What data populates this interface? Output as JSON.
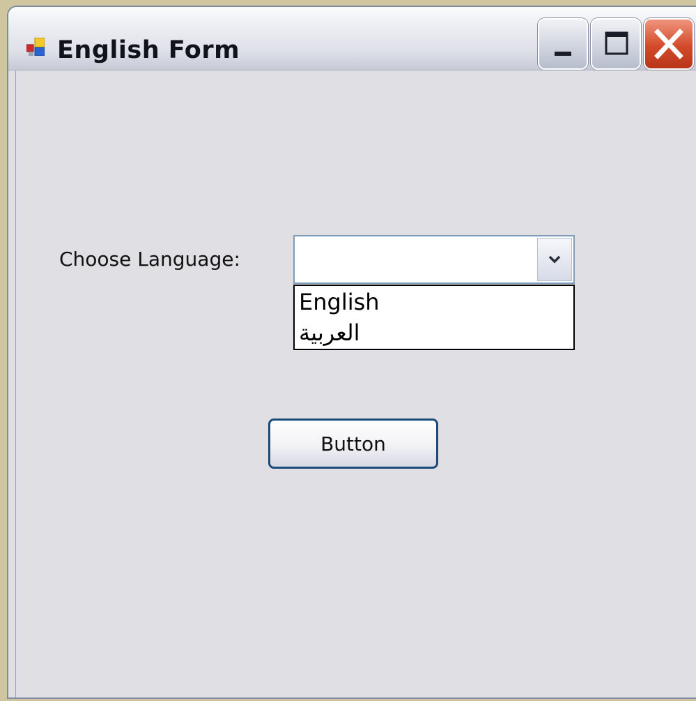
{
  "window": {
    "title": "English Form",
    "controls": [
      "minimize",
      "maximize",
      "close"
    ]
  },
  "form": {
    "language_label": "Choose Language:",
    "language_combo": {
      "selected": "",
      "options": [
        "English",
        "العربية"
      ]
    },
    "button_label": "Button"
  },
  "icons": {
    "app": "window-app-icon",
    "minimize": "minimize-icon",
    "maximize": "maximize-icon",
    "close": "close-icon",
    "dropdown": "chevron-down-icon"
  },
  "colors": {
    "close_button": "#d24a2a",
    "button_border": "#1c4a7a",
    "client_bg": "#e0e0e4"
  }
}
